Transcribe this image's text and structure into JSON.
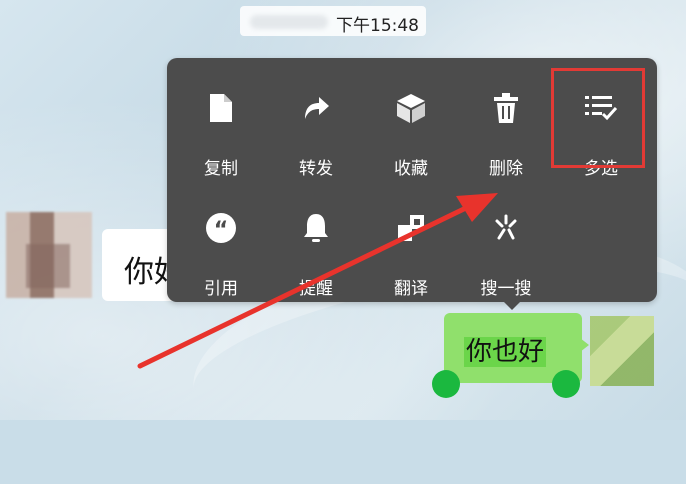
{
  "status": {
    "time": "下午15:48"
  },
  "chat": {
    "incoming_message": "你好",
    "outgoing_message": "你也好"
  },
  "context_menu": {
    "row1": [
      {
        "label": "复制",
        "icon": "copy-icon"
      },
      {
        "label": "转发",
        "icon": "forward-icon"
      },
      {
        "label": "收藏",
        "icon": "favorite-icon"
      },
      {
        "label": "删除",
        "icon": "delete-icon"
      },
      {
        "label": "多选",
        "icon": "multi-select-icon"
      }
    ],
    "row2": [
      {
        "label": "引用",
        "icon": "quote-icon"
      },
      {
        "label": "提醒",
        "icon": "bell-icon"
      },
      {
        "label": "翻译",
        "icon": "translate-icon"
      },
      {
        "label": "搜一搜",
        "icon": "search-sparkle-icon"
      }
    ]
  },
  "colors": {
    "menu_bg": "#4c4c4c",
    "highlight": "#e23a35",
    "outgoing_bubble": "#90e06c",
    "selection_handle": "#1bb83f"
  }
}
